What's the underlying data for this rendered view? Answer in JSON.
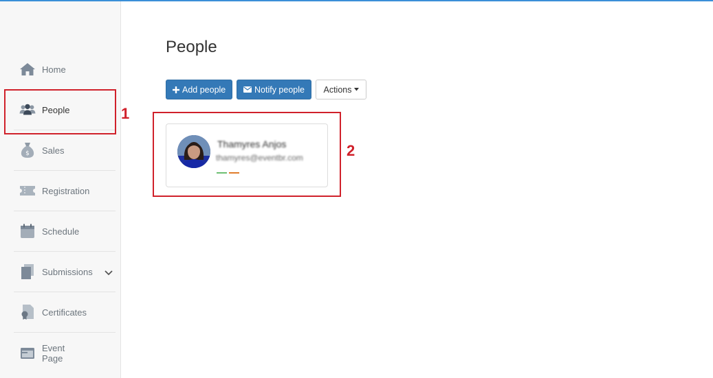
{
  "sidebar": {
    "items": [
      {
        "label": "Home",
        "icon": "home-icon"
      },
      {
        "label": "People",
        "icon": "people-icon",
        "active": true
      },
      {
        "label": "Sales",
        "icon": "money-bag-icon"
      },
      {
        "label": "Registration",
        "icon": "ticket-icon"
      },
      {
        "label": "Schedule",
        "icon": "calendar-icon"
      },
      {
        "label": "Submissions",
        "icon": "documents-icon"
      },
      {
        "label": "Certificates",
        "icon": "certificate-icon"
      },
      {
        "label": "Event Page",
        "icon": "browser-window-icon"
      }
    ]
  },
  "main": {
    "title": "People",
    "toolbar": {
      "add_label": "Add people",
      "notify_label": "Notify people",
      "actions_label": "Actions"
    },
    "person_card": {
      "name": "Thamyres Anjos",
      "email": "thamyres@eventbr.com",
      "tag_colors": [
        "#6cbf72",
        "#e07b2a"
      ]
    }
  },
  "annotations": {
    "box1_number": "1",
    "box2_number": "2"
  },
  "colors": {
    "primary": "#3479b7",
    "annotation": "#d0202a"
  }
}
